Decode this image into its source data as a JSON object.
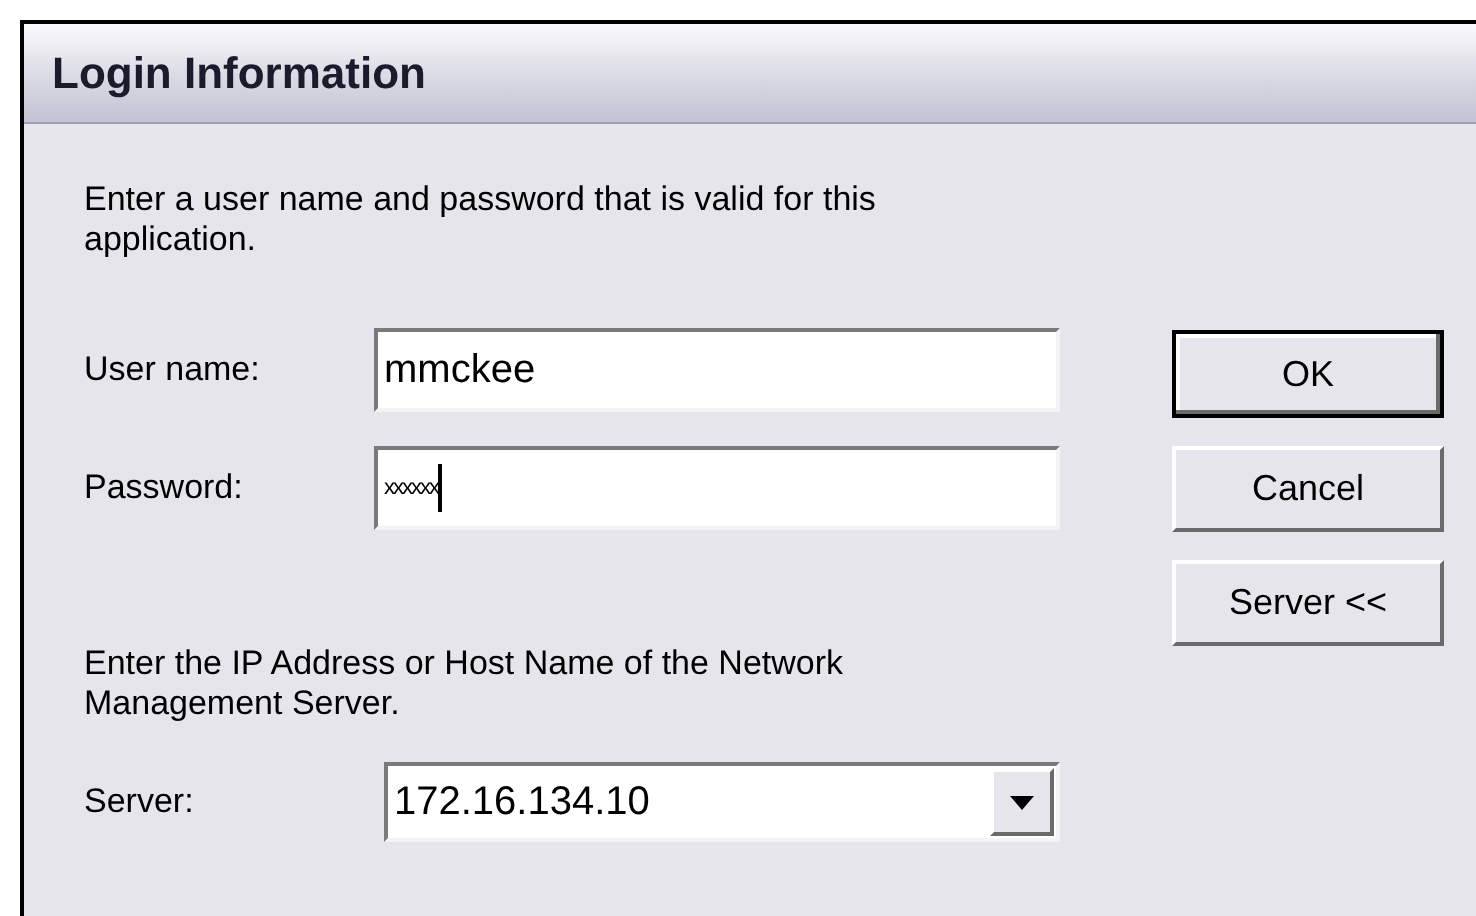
{
  "window": {
    "title": "Login Information"
  },
  "instruction": "Enter a user name and password that is valid for this application.",
  "fields": [
    {
      "label": "User name:",
      "value": "mmckee",
      "kind": "text",
      "focused": false
    },
    {
      "label": "Password:",
      "value": "xxxxxx",
      "kind": "password",
      "focused": true
    }
  ],
  "buttons": [
    {
      "label": "OK",
      "default": true
    },
    {
      "label": "Cancel",
      "default": false
    },
    {
      "label": "Server <<",
      "default": false
    }
  ],
  "server_instruction": "Enter the IP Address or Host Name of the Network Management Server.",
  "server": {
    "label": "Server:",
    "value": "172.16.134.10"
  }
}
